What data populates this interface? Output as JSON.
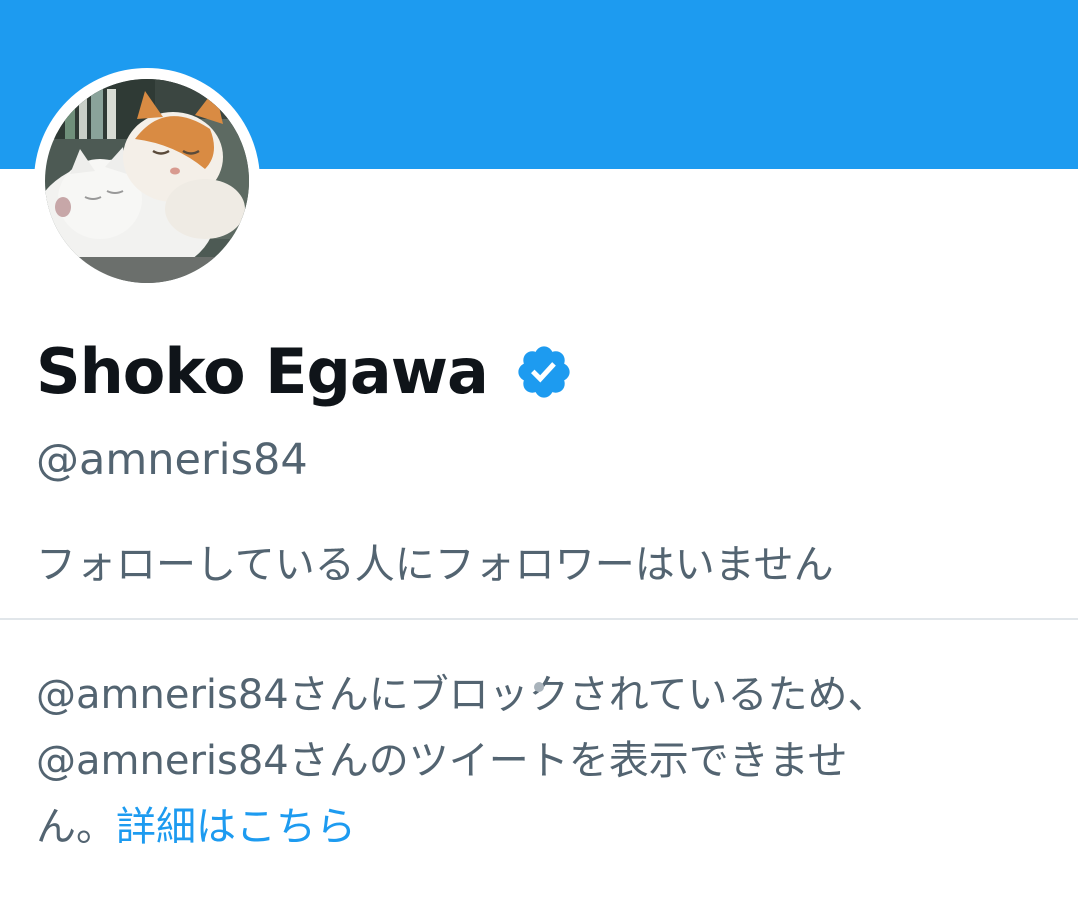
{
  "profile": {
    "display_name": "Shoko Egawa",
    "handle": "@amneris84",
    "verified_icon": "verified-badge-icon",
    "follow_note": "フォローしている人にフォロワーはいません"
  },
  "blocked": {
    "line1": "@amneris84さんにブロックされているため、",
    "line2": "@amneris84さんのツイートを表示できませ",
    "line3_prefix": "ん。",
    "learn_more": "詳細はこちら"
  },
  "colors": {
    "banner": "#1d9bf0",
    "accent": "#1d9bf0",
    "primary_text": "#0f1419",
    "secondary_text": "#536471"
  }
}
